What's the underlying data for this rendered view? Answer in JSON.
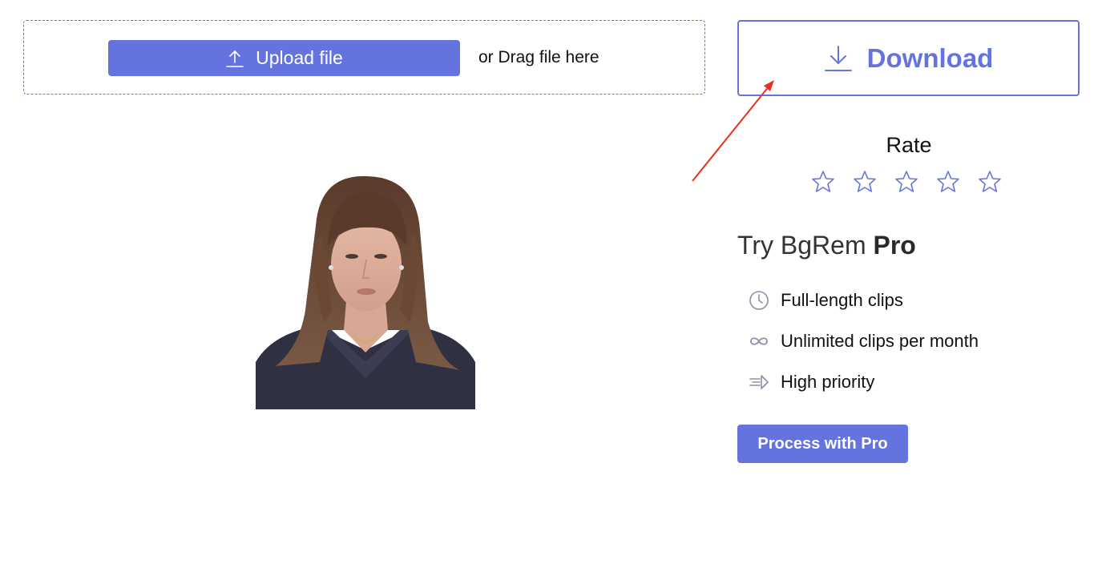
{
  "upload": {
    "button_label": "Upload file",
    "button_icon": "upload-icon",
    "drag_text": "or Drag file here"
  },
  "download": {
    "label": "Download",
    "icon": "download-icon"
  },
  "rating": {
    "title": "Rate",
    "stars_total": 5,
    "stars_selected": 0
  },
  "pro": {
    "title_prefix": "Try BgRem ",
    "title_bold": "Pro",
    "features": [
      {
        "icon": "clock-icon",
        "label": "Full-length clips"
      },
      {
        "icon": "infinity-icon",
        "label": "Unlimited clips per month"
      },
      {
        "icon": "priority-arrow-icon",
        "label": "High priority"
      }
    ],
    "button_label": "Process with Pro"
  },
  "colors": {
    "accent": "#6573e0",
    "annotation_arrow": "#e8321e"
  }
}
